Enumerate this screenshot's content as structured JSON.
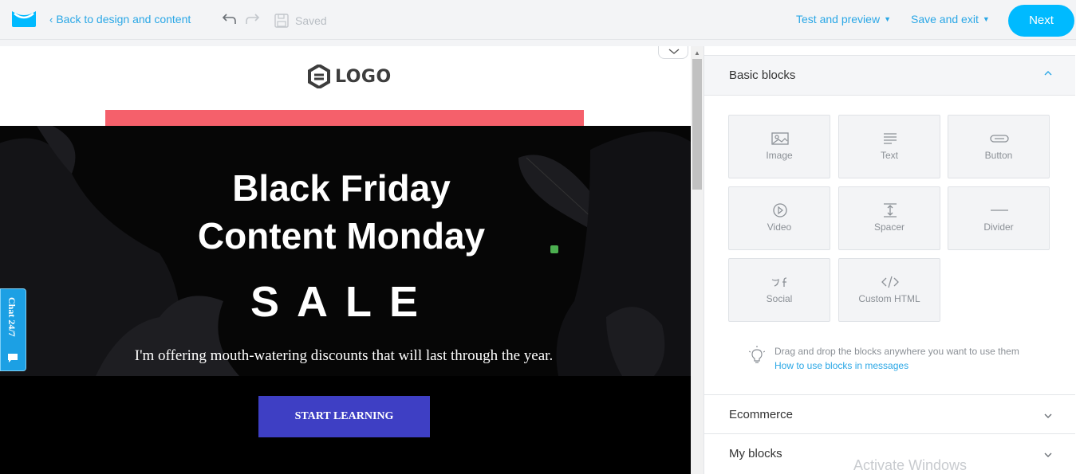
{
  "topbar": {
    "back_label": "Back to design and content",
    "saved_label": "Saved",
    "test_label": "Test and preview",
    "save_exit_label": "Save and exit",
    "next_label": "Next"
  },
  "email": {
    "logo_text": "LOGO",
    "title_line1": "Black Friday",
    "title_line2": "Content Monday",
    "sale": "SALE",
    "subtitle": "I'm offering mouth-watering discounts that will last through the year.",
    "cta_label": "START LEARNING"
  },
  "chat": {
    "label": "Chat 24/7"
  },
  "panel": {
    "basic_title": "Basic blocks",
    "blocks": [
      {
        "label": "Image",
        "icon": "image-icon"
      },
      {
        "label": "Text",
        "icon": "text-icon"
      },
      {
        "label": "Button",
        "icon": "button-icon"
      },
      {
        "label": "Video",
        "icon": "video-icon"
      },
      {
        "label": "Spacer",
        "icon": "spacer-icon"
      },
      {
        "label": "Divider",
        "icon": "divider-icon"
      },
      {
        "label": "Social",
        "icon": "social-icon"
      },
      {
        "label": "Custom HTML",
        "icon": "code-icon"
      }
    ],
    "hint_text": "Drag and drop the blocks anywhere you want to use them",
    "hint_link": "How to use blocks in messages",
    "ecommerce_title": "Ecommerce",
    "my_blocks_title": "My blocks"
  },
  "watermark": {
    "text": "Activate Windows"
  },
  "colors": {
    "accent": "#00baff",
    "link": "#2aa7e6",
    "pink_bar": "#f5606b",
    "cta": "#3e3fc4",
    "hero_bg": "#060606"
  }
}
